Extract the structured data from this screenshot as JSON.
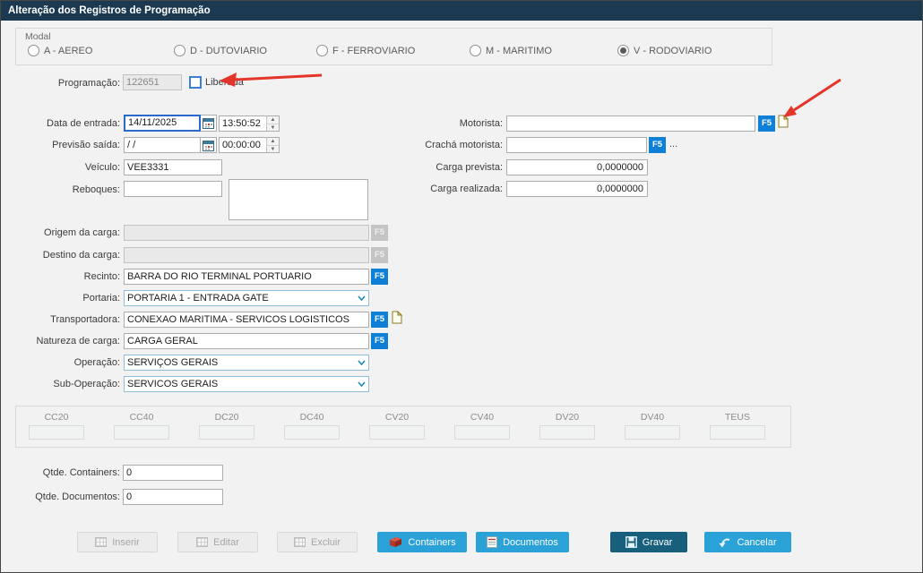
{
  "window_title": "Alteração dos Registros de Programação",
  "modal": {
    "label": "Modal",
    "options": [
      {
        "label": "A - AEREO",
        "selected": false
      },
      {
        "label": "D - DUTOVIARIO",
        "selected": false
      },
      {
        "label": "F - FERROVIARIO",
        "selected": false
      },
      {
        "label": "M - MARITIMO",
        "selected": false
      },
      {
        "label": "V - RODOVIARIO",
        "selected": true
      }
    ]
  },
  "programacao": {
    "label": "Programação:",
    "value": "122651",
    "liberada_label": "Liberada",
    "liberada_checked": false
  },
  "rows": {
    "data_entrada": {
      "label": "Data de entrada:",
      "date": "14/11/2025",
      "time": "13:50:52"
    },
    "previsao_saida": {
      "label": "Previsão saída:",
      "date": "/  /",
      "time": "00:00:00"
    },
    "veiculo": {
      "label": "Veículo:",
      "value": "VEE3331"
    },
    "reboques": {
      "label": "Reboques:",
      "value": ""
    },
    "origem": {
      "label": "Origem da carga:",
      "value": ""
    },
    "destino": {
      "label": "Destino da carga:",
      "value": ""
    },
    "recinto": {
      "label": "Recinto:",
      "value": "BARRA DO RIO TERMINAL PORTUARIO"
    },
    "portaria": {
      "label": "Portaria:",
      "value": "PORTARIA 1 - ENTRADA GATE"
    },
    "transportadora": {
      "label": "Transportadora:",
      "value": "CONEXAO MARITIMA - SERVICOS LOGISTICOS"
    },
    "natureza": {
      "label": "Natureza de carga:",
      "value": "CARGA GERAL"
    },
    "operacao": {
      "label": "Operação:",
      "value": "SERVIÇOS GERAIS"
    },
    "sub_operacao": {
      "label": "Sub-Operação:",
      "value": "SERVICOS GERAIS"
    },
    "motorista": {
      "label": "Motorista:",
      "value": ""
    },
    "cracha": {
      "label": "Crachá motorista:",
      "value": "",
      "more": "..."
    },
    "carga_prevista": {
      "label": "Carga prevista:",
      "value": "0,0000000"
    },
    "carga_realizada": {
      "label": "Carga realizada:",
      "value": "0,0000000"
    },
    "qtde_containers": {
      "label": "Qtde. Containers:",
      "value": "0"
    },
    "qtde_documentos": {
      "label": "Qtde. Documentos:",
      "value": "0"
    }
  },
  "containers_group": {
    "columns": [
      "CC20",
      "CC40",
      "DC20",
      "DC40",
      "CV20",
      "CV40",
      "DV20",
      "DV40",
      "TEUS"
    ]
  },
  "f5": "F5",
  "icons": {
    "spinner_up": "▲",
    "spinner_down": "▼"
  },
  "buttons": {
    "inserir": "Inserir",
    "editar": "Editar",
    "excluir": "Excluir",
    "containers": "Containers",
    "documentos": "Documentos",
    "gravar": "Gravar",
    "cancelar": "Cancelar"
  },
  "colors": {
    "titlebar": "#1b3a52",
    "accent_blue": "#2aa2d8",
    "f5_blue": "#0e80d8",
    "gravar_button": "#175f7d",
    "arrow_red": "#e5352b",
    "focus_blue": "#2a68cc"
  }
}
